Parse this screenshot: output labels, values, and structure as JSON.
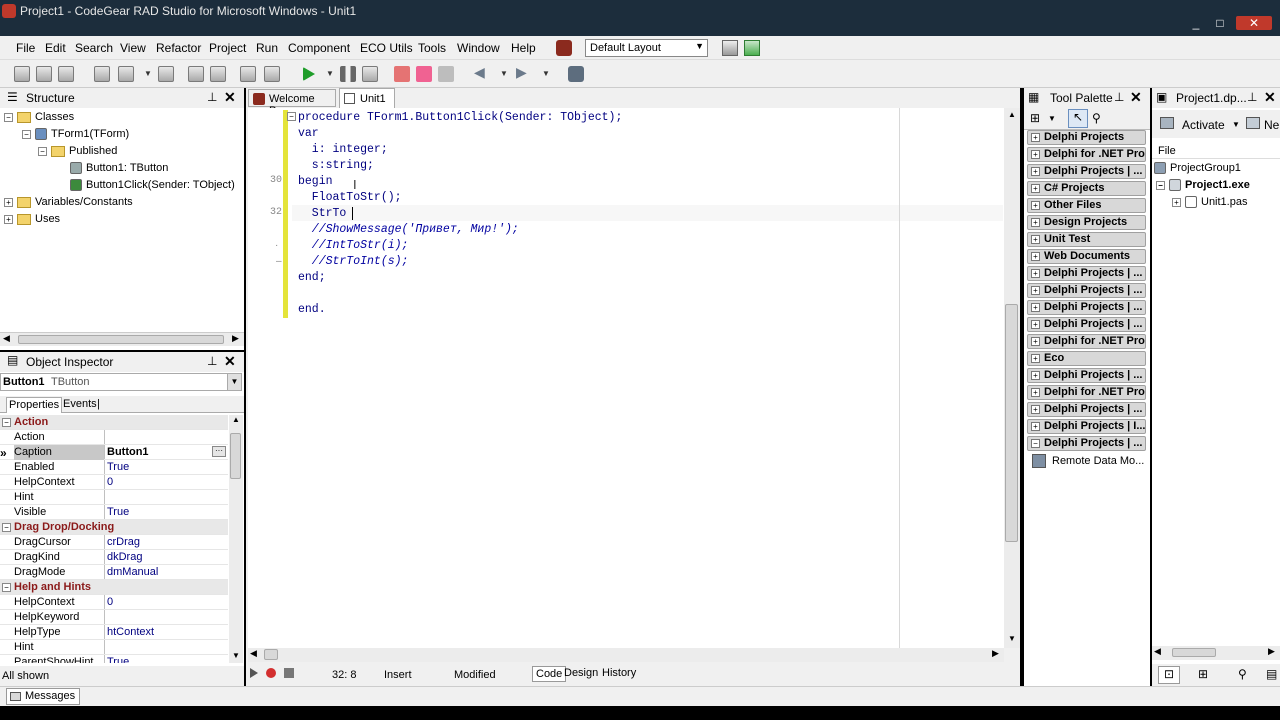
{
  "window": {
    "title": "Project1 - CodeGear RAD Studio for Microsoft Windows - Unit1",
    "minimize": "_",
    "maximize": "□",
    "close": "✕"
  },
  "menu": [
    "File",
    "Edit",
    "Search",
    "View",
    "Refactor",
    "Project",
    "Run",
    "Component",
    "ECO Utils",
    "Tools",
    "Window",
    "Help"
  ],
  "layout_select": "Default Layout",
  "structure": {
    "title": "Structure",
    "nodes": [
      {
        "label": "Classes",
        "expander": "-"
      },
      {
        "label": "TForm1(TForm)",
        "expander": "-"
      },
      {
        "label": "Published",
        "expander": "-"
      },
      {
        "label": "Button1: TButton",
        "expander": ""
      },
      {
        "label": "Button1Click(Sender: TObject)",
        "expander": ""
      },
      {
        "label": "Variables/Constants",
        "expander": "+"
      },
      {
        "label": "Uses",
        "expander": "+"
      }
    ]
  },
  "object_inspector": {
    "title": "Object Inspector",
    "selected_name": "Button1",
    "selected_type": "TButton",
    "tabs": [
      "Properties",
      "Events"
    ],
    "rows": [
      {
        "k": "Action",
        "v": "",
        "cat": true
      },
      {
        "k": "Action",
        "v": ""
      },
      {
        "k": "Caption",
        "v": "Button1",
        "sel": true
      },
      {
        "k": "Enabled",
        "v": "True"
      },
      {
        "k": "HelpContext",
        "v": "0"
      },
      {
        "k": "Hint",
        "v": ""
      },
      {
        "k": "Visible",
        "v": "True"
      },
      {
        "k": "Drag Drop/Docking",
        "v": "",
        "cat": true
      },
      {
        "k": "DragCursor",
        "v": "crDrag"
      },
      {
        "k": "DragKind",
        "v": "dkDrag"
      },
      {
        "k": "DragMode",
        "v": "dmManual"
      },
      {
        "k": "Help and Hints",
        "v": "",
        "cat": true
      },
      {
        "k": "HelpContext",
        "v": "0"
      },
      {
        "k": "HelpKeyword",
        "v": ""
      },
      {
        "k": "HelpType",
        "v": "htContext"
      },
      {
        "k": "Hint",
        "v": ""
      },
      {
        "k": "ParentShowHint",
        "v": "True"
      }
    ],
    "footer": "All shown"
  },
  "editor": {
    "tabs": [
      "Welcome Page",
      "Unit1"
    ],
    "line_numbers": [
      "30",
      "32"
    ],
    "lines": [
      {
        "text": "procedure TForm1.Button1Click(Sender: TObject);",
        "cls": "kw"
      },
      {
        "text": "var",
        "cls": "kw"
      },
      {
        "text": "  i: integer;",
        "cls": "kw"
      },
      {
        "text": "  s:string;",
        "cls": "kw"
      },
      {
        "text": "begin",
        "cls": "kw"
      },
      {
        "text": "  FloatToStr();",
        "cls": "kw"
      },
      {
        "text": "  StrTo",
        "cls": "kw"
      },
      {
        "text": "  //ShowMessage('Привет, Мир!');",
        "cls": "cm"
      },
      {
        "text": "  //IntToStr(i);",
        "cls": "cm"
      },
      {
        "text": "  //StrToInt(s);",
        "cls": "cm"
      },
      {
        "text": "end;",
        "cls": "kw"
      },
      {
        "text": "",
        "cls": "kw"
      },
      {
        "text": "end.",
        "cls": "kw"
      }
    ],
    "status": {
      "position": "32:  8",
      "mode": "Insert",
      "state": "Modified"
    },
    "bottom_tabs": [
      "Code",
      "Design",
      "History"
    ]
  },
  "tool_palette": {
    "title": "Tool Palette",
    "categories": [
      "Delphi Projects",
      "Delphi for .NET Pro...",
      "Delphi Projects | ...",
      "C# Projects",
      "Other Files",
      "Design Projects",
      "Unit Test",
      "Web Documents",
      "Delphi Projects | ...",
      "Delphi Projects | ...",
      "Delphi Projects | ...",
      "Delphi Projects | ...",
      "Delphi for .NET Pro...",
      "Eco",
      "Delphi Projects | ...",
      "Delphi for .NET Pro...",
      "Delphi Projects | ...",
      "Delphi Projects | I...",
      "Delphi Projects | ..."
    ],
    "item": "Remote Data Mo..."
  },
  "project_manager": {
    "title": "Project1.dp...",
    "activate": "Activate",
    "new": "Ne",
    "header": "File",
    "nodes": [
      "ProjectGroup1",
      "Project1.exe",
      "Unit1.pas"
    ]
  },
  "messages_tab": "Messages"
}
